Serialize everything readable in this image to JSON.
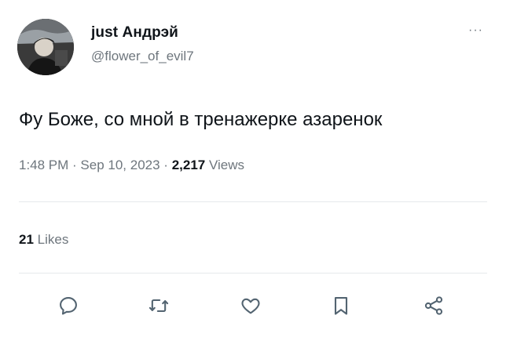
{
  "user": {
    "display_name": "just Андрэй",
    "handle": "@flower_of_evil7",
    "avatar_icon": "profile-photo"
  },
  "menu": {
    "more_label": "···"
  },
  "tweet": {
    "text": "Фу Боже, со мной в тренажерке азаренок"
  },
  "meta": {
    "time": "1:48 PM",
    "separator": " · ",
    "date": "Sep 10, 2023",
    "views_count": "2,217",
    "views_label": "Views"
  },
  "stats": {
    "likes_count": "21",
    "likes_label": "Likes"
  },
  "actions": [
    {
      "name": "reply",
      "icon": "reply-icon"
    },
    {
      "name": "retweet",
      "icon": "retweet-icon"
    },
    {
      "name": "like",
      "icon": "heart-icon"
    },
    {
      "name": "bookmark",
      "icon": "bookmark-icon"
    },
    {
      "name": "share",
      "icon": "share-icon"
    }
  ],
  "colors": {
    "text": "#0f1419",
    "secondary": "#6e767d",
    "divider": "#e6e9ec",
    "background": "#ffffff"
  }
}
